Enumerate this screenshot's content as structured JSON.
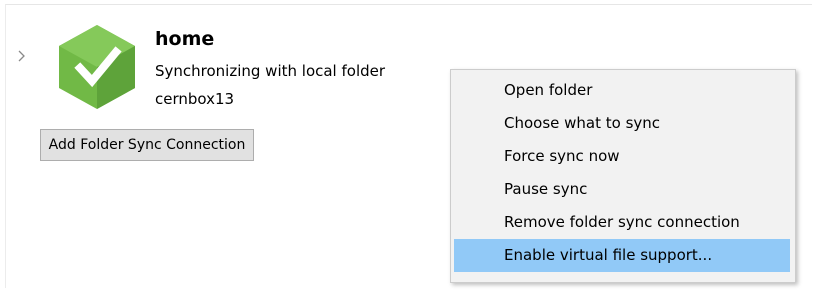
{
  "folder": {
    "title": "home",
    "status": "Synchronizing with local folder",
    "account": "cernbox13",
    "status_icon": "checkmark-icon",
    "status_color": "#6ab63d"
  },
  "actions": {
    "add_connection_label": "Add Folder Sync Connection"
  },
  "context_menu": {
    "items": [
      {
        "label": "Open folder",
        "highlighted": false
      },
      {
        "label": "Choose what to sync",
        "highlighted": false
      },
      {
        "label": "Force sync now",
        "highlighted": false
      },
      {
        "label": "Pause sync",
        "highlighted": false
      },
      {
        "label": "Remove folder sync connection",
        "highlighted": false
      },
      {
        "label": "Enable virtual file support...",
        "highlighted": true
      }
    ],
    "highlight_color": "#91c9f7"
  }
}
